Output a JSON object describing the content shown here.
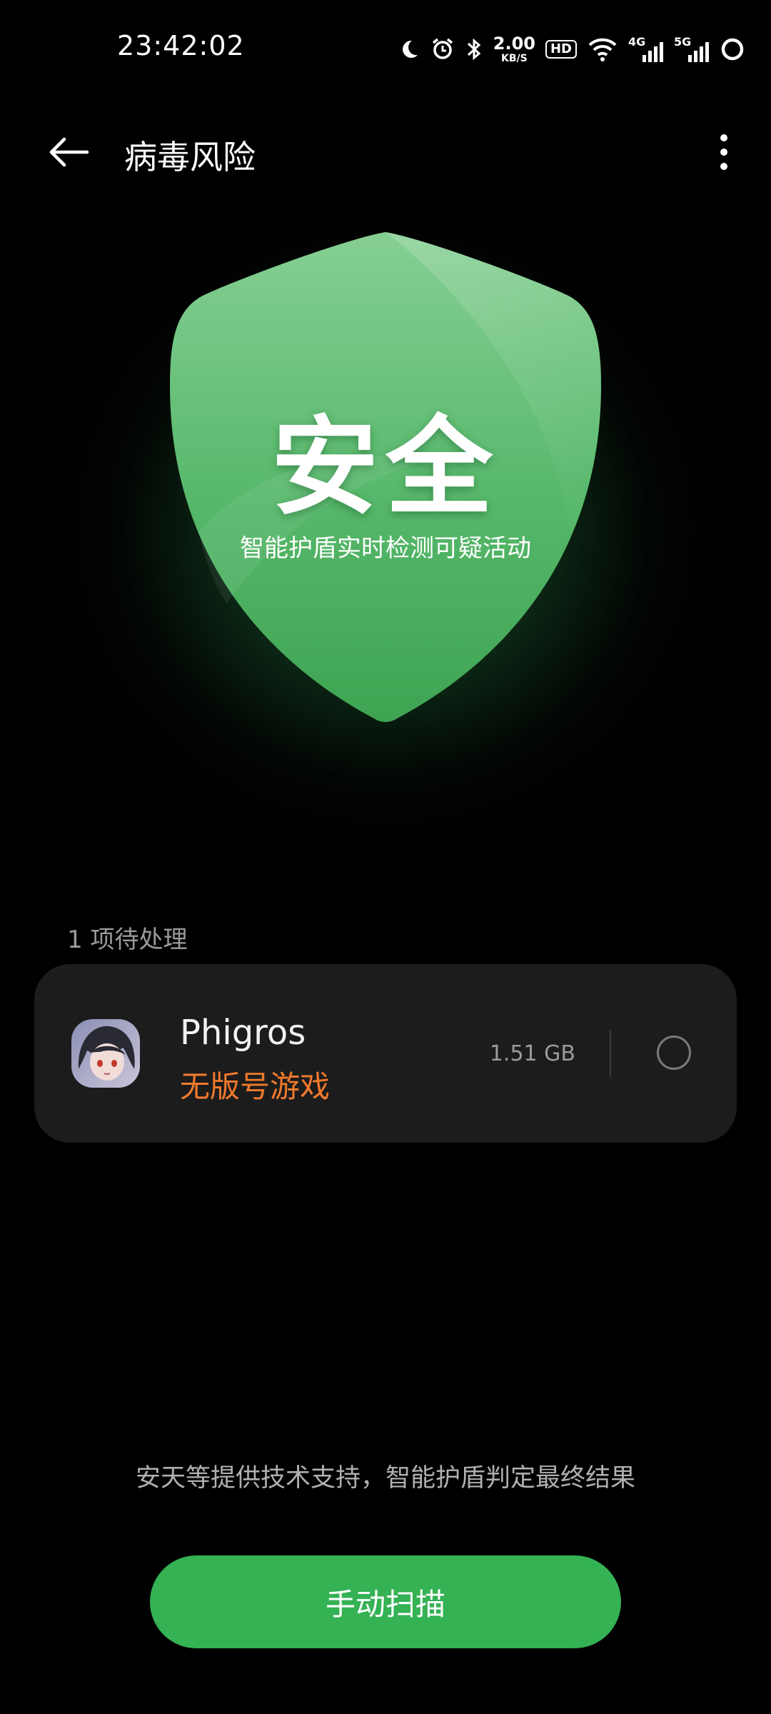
{
  "status_bar": {
    "time": "23:42:02",
    "net_speed_value": "2.00",
    "net_speed_unit": "KB/S",
    "hd_badge": "HD",
    "signal1_label": "4G",
    "signal2_label": "5G",
    "icons": [
      "moon-icon",
      "alarm-icon",
      "bluetooth-icon",
      "wifi-icon",
      "signal-icon",
      "battery-ring-icon"
    ]
  },
  "header": {
    "title": "病毒风险",
    "back_icon": "arrow-left-icon",
    "more_icon": "more-vertical-icon"
  },
  "shield": {
    "status": "安全",
    "subtitle": "智能护盾实时检测可疑活动",
    "color": "#4caf63"
  },
  "pending": {
    "label": "1 项待处理",
    "items": [
      {
        "name": "Phigros",
        "risk": "无版号游戏",
        "size": "1.51 GB",
        "selected": false
      }
    ]
  },
  "footer": {
    "note": "安天等提供技术支持，智能护盾判定最终结果",
    "scan_button": "手动扫描"
  },
  "colors": {
    "background": "#000000",
    "card": "#1c1c1c",
    "accent_green": "#34b254",
    "warning_orange": "#f07a2c"
  }
}
